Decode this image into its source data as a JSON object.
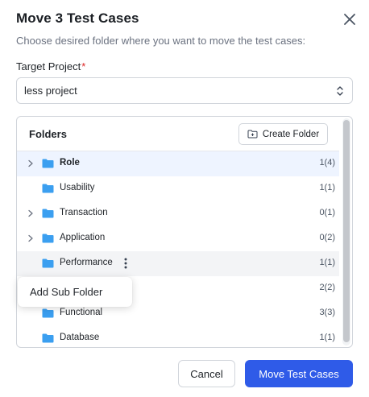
{
  "dialog": {
    "title": "Move 3 Test Cases",
    "subtitle": "Choose desired folder where you want to move the test cases:",
    "close_icon": "close-icon"
  },
  "target_project": {
    "label": "Target Project",
    "required_marker": "*",
    "value": "less project",
    "icon": "chevron-up-down-icon"
  },
  "folders": {
    "title": "Folders",
    "create_button_label": "Create Folder",
    "create_button_icon": "folder-plus-icon",
    "items": [
      {
        "name": "Role",
        "count": "1(4)",
        "expandable": true,
        "selected": true
      },
      {
        "name": "Usability",
        "count": "1(1)",
        "expandable": false
      },
      {
        "name": "Transaction",
        "count": "0(1)",
        "expandable": true
      },
      {
        "name": "Application",
        "count": "0(2)",
        "expandable": true
      },
      {
        "name": "Performance",
        "count": "1(1)",
        "expandable": false,
        "hovered": true
      },
      {
        "name": "",
        "count": "2(2)",
        "expandable": false
      },
      {
        "name": "Functional",
        "count": "3(3)",
        "expandable": false
      },
      {
        "name": "Database",
        "count": "1(1)",
        "expandable": false
      }
    ]
  },
  "context_menu": {
    "item_label": "Add Sub Folder"
  },
  "footer": {
    "cancel_label": "Cancel",
    "primary_label": "Move Test Cases"
  },
  "colors": {
    "primary": "#2f5be8",
    "folder": "#3b9ff0",
    "selected_row": "#eef4ff",
    "required": "#dc2626"
  }
}
